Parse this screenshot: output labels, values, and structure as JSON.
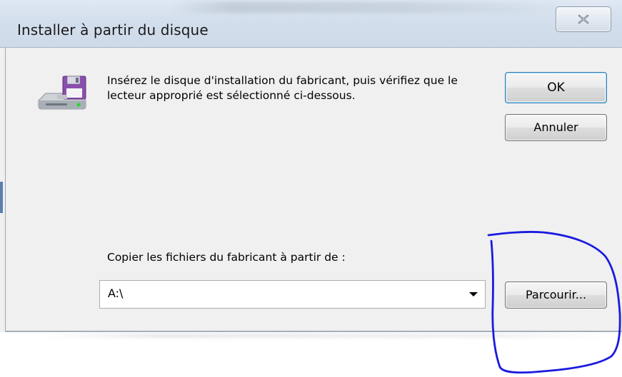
{
  "window": {
    "title": "Installer à partir du disque"
  },
  "dialog": {
    "instruction": "Insérez le disque d'installation du fabricant, puis vérifiez que le lecteur approprié est sélectionné ci-dessous.",
    "ok_label": "OK",
    "cancel_label": "Annuler",
    "copy_from_label": "Copier les fichiers du fabricant à partir de :",
    "path_value": "A:\\",
    "browse_label": "Parcourir..."
  },
  "icons": {
    "close": "close-icon",
    "disk": "disk-drive-icon",
    "dropdown": "chevron-down-icon"
  },
  "colors": {
    "annotation": "#1a1ae0",
    "dialog_bg": "#f0f0f0",
    "ok_focus_border": "#3c7fb1"
  }
}
